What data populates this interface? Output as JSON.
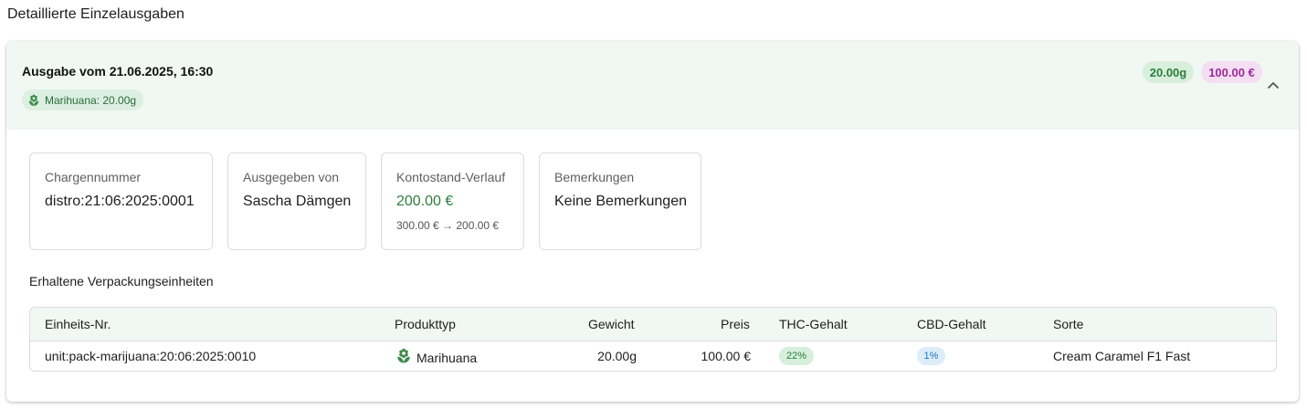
{
  "section_title": "Detaillierte Einzelausgaben",
  "dispense": {
    "title": "Ausgabe vom 21.06.2025, 16:30",
    "product_chip": "Marihuana: 20.00g",
    "weight_badge": "20.00g",
    "price_badge": "100.00 €",
    "collapse_icon": "chevron-up-icon"
  },
  "info": {
    "batch": {
      "label": "Chargennummer",
      "value": "distro:21:06:2025:0001"
    },
    "issued_by": {
      "label": "Ausgegeben von",
      "value": "Sascha Dämgen"
    },
    "balance": {
      "label": "Kontostand-Verlauf",
      "value": "200.00 €",
      "sub": "300.00 € → 200.00 €"
    },
    "remarks": {
      "label": "Bemerkungen",
      "value": "Keine Bemerkungen"
    }
  },
  "units": {
    "title": "Erhaltene Verpackungseinheiten",
    "columns": [
      "Einheits-Nr.",
      "Produkttyp",
      "Gewicht",
      "Preis",
      "THC-Gehalt",
      "CBD-Gehalt",
      "Sorte"
    ],
    "rows": [
      {
        "unit_no": "unit:pack-marijuana:20:06:2025:0010",
        "product_type": "Marihuana",
        "weight": "20.00g",
        "price": "100.00 €",
        "thc": "22%",
        "cbd": "1%",
        "strain": "Cream Caramel F1 Fast"
      }
    ]
  },
  "colors": {
    "accent_green": "#2e7d3c",
    "header_bg": "#f1f7f3",
    "price_purple": "#9c2b9e",
    "cbd_blue": "#1d74c7"
  }
}
